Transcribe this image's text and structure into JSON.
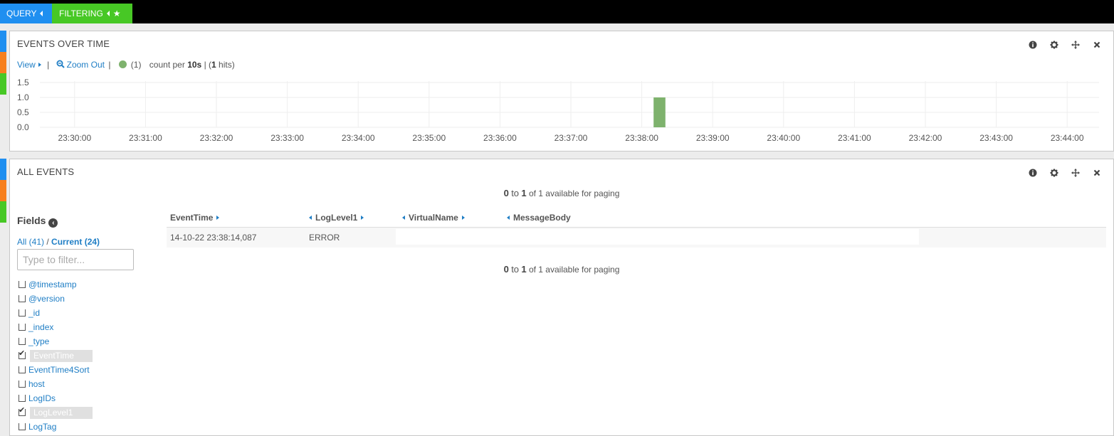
{
  "topbar": {
    "query_label": "QUERY",
    "filtering_label": "FILTERING",
    "colors": {
      "query": "#1f8ff0",
      "filtering": "#47c825"
    }
  },
  "row_tab_colors": [
    "#1f8ff0",
    "#f7801e",
    "#47c825"
  ],
  "events_over_time": {
    "title": "EVENTS OVER TIME",
    "icons": [
      "info-icon",
      "gear-icon",
      "move-icon",
      "close-icon"
    ],
    "view_label": "View",
    "zoom_out_label": "Zoom Out",
    "separator": "|",
    "legend_count": "(1)",
    "count_per_prefix": "count per",
    "interval": "10s",
    "hits_open": "| (",
    "hits_value": "1",
    "hits_close": "hits)"
  },
  "chart_data": {
    "type": "bar",
    "title": "EVENTS OVER TIME",
    "xlabel": "",
    "ylabel": "count per 10s",
    "y_ticks": [
      "0.0",
      "0.5",
      "1.0",
      "1.5"
    ],
    "ylim": [
      0,
      1.5
    ],
    "x_ticks": [
      "23:30:00",
      "23:31:00",
      "23:32:00",
      "23:33:00",
      "23:34:00",
      "23:35:00",
      "23:36:00",
      "23:37:00",
      "23:38:00",
      "23:39:00",
      "23:40:00",
      "23:41:00",
      "23:42:00",
      "23:43:00",
      "23:44:00"
    ],
    "xlim_minutes_from_2330": [
      -0.49,
      14.45
    ],
    "grid": true,
    "series": [
      {
        "name": "(1)",
        "color": "#7eb26d",
        "points": [
          {
            "x": "23:38:10",
            "minutes_from_2330": 8.1667,
            "value": 1
          }
        ]
      }
    ],
    "bucket_seconds": 10
  },
  "all_events": {
    "title": "ALL EVENTS",
    "icons": [
      "info-icon",
      "gear-icon",
      "move-icon",
      "close-icon"
    ],
    "paging": {
      "from": "0",
      "to_word": "to",
      "to": "1",
      "suffix": "of 1 available for paging"
    },
    "fields": {
      "title": "Fields",
      "all_label": "All (41)",
      "slash": " / ",
      "current_label": "Current (24)",
      "filter_placeholder": "Type to filter...",
      "items": [
        {
          "name": "@timestamp",
          "checked": false
        },
        {
          "name": "@version",
          "checked": false
        },
        {
          "name": "_id",
          "checked": false
        },
        {
          "name": "_index",
          "checked": false
        },
        {
          "name": "_type",
          "checked": false
        },
        {
          "name": "EventTime",
          "checked": true
        },
        {
          "name": "EventTime4Sort",
          "checked": false
        },
        {
          "name": "host",
          "checked": false
        },
        {
          "name": "LogIDs",
          "checked": false
        },
        {
          "name": "LogLevel1",
          "checked": true
        },
        {
          "name": "LogTag",
          "checked": false
        }
      ]
    },
    "table": {
      "columns": [
        "EventTime",
        "LogLevel1",
        "VirtualName",
        "MessageBody"
      ],
      "rows": [
        [
          "14-10-22 23:38:14,087",
          "ERROR",
          "",
          ""
        ]
      ]
    }
  }
}
